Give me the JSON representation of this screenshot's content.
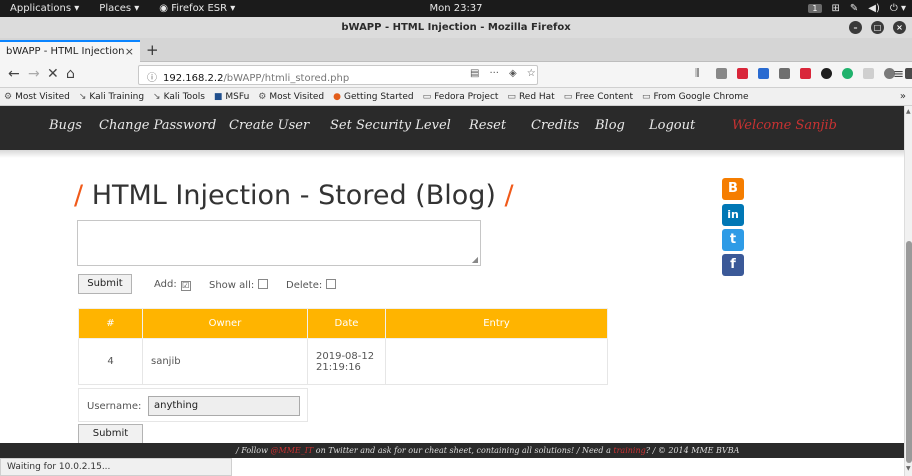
{
  "topbar": {
    "applications": "Applications ▾",
    "places": "Places ▾",
    "firefox": "Firefox ESR ▾",
    "clock": "Mon 23:37",
    "workspace": "1"
  },
  "window": {
    "title": "bWAPP - HTML Injection - Mozilla Firefox"
  },
  "tab": {
    "label": "bWAPP - HTML Injection",
    "close": "×",
    "new_tab": "+"
  },
  "urlbar": {
    "host": "192.168.2.2",
    "path": "/bWAPP/htmli_stored.php",
    "more": "···"
  },
  "bookmarks": [
    {
      "label": "Most Visited",
      "icon": "gear-icon",
      "glyph": "⚙"
    },
    {
      "label": "Kali Training",
      "icon": "kali-icon",
      "glyph": "↘"
    },
    {
      "label": "Kali Tools",
      "icon": "kali-icon",
      "glyph": "↘"
    },
    {
      "label": "MSFu",
      "icon": "msf-icon",
      "glyph": "■"
    },
    {
      "label": "Most Visited",
      "icon": "gear-icon",
      "glyph": "⚙"
    },
    {
      "label": "Getting Started",
      "icon": "firefox-icon",
      "glyph": "●"
    },
    {
      "label": "Fedora Project",
      "icon": "folder-icon",
      "glyph": "▭"
    },
    {
      "label": "Red Hat",
      "icon": "folder-icon",
      "glyph": "▭"
    },
    {
      "label": "Free Content",
      "icon": "folder-icon",
      "glyph": "▭"
    },
    {
      "label": "From Google Chrome",
      "icon": "folder-icon",
      "glyph": "▭"
    }
  ],
  "menu": {
    "bugs": "Bugs",
    "change_password": "Change Password",
    "create_user": "Create User",
    "security_level": "Set Security Level",
    "reset": "Reset",
    "credits": "Credits",
    "blog": "Blog",
    "logout": "Logout",
    "welcome": "Welcome Sanjib"
  },
  "heading": {
    "slash_left": "/",
    "title": "HTML Injection - Stored (Blog)",
    "slash_right": "/"
  },
  "form": {
    "submit": "Submit",
    "add_label": "Add:",
    "add_checked": "☑",
    "show_all_label": "Show all:",
    "delete_label": "Delete:"
  },
  "table": {
    "headers": [
      "#",
      "Owner",
      "Date",
      "Entry"
    ],
    "rows": [
      {
        "id": "4",
        "owner": "sanjib",
        "date_line1": "2019-08-12",
        "date_line2": "21:19:16",
        "entry": ""
      }
    ]
  },
  "username": {
    "label": "Username:",
    "value": "anything"
  },
  "submit2": "Submit",
  "social": [
    {
      "name": "blogger-icon",
      "glyph": "B",
      "color": "#f57d00"
    },
    {
      "name": "linkedin-icon",
      "glyph": "in",
      "color": "#0077b5"
    },
    {
      "name": "twitter-icon",
      "glyph": "t",
      "color": "#2e9be6"
    },
    {
      "name": "facebook-icon",
      "glyph": "f",
      "color": "#3b5998"
    }
  ],
  "footer": {
    "pre": "/ Follow ",
    "link1": "@MME_IT",
    "mid": " on Twitter and ask for our cheat sheet, containing all solutions! / Need a ",
    "link2": "training",
    "post": "? / © 2014 MME BVBA"
  },
  "status": "Waiting for 10.0.2.15..."
}
